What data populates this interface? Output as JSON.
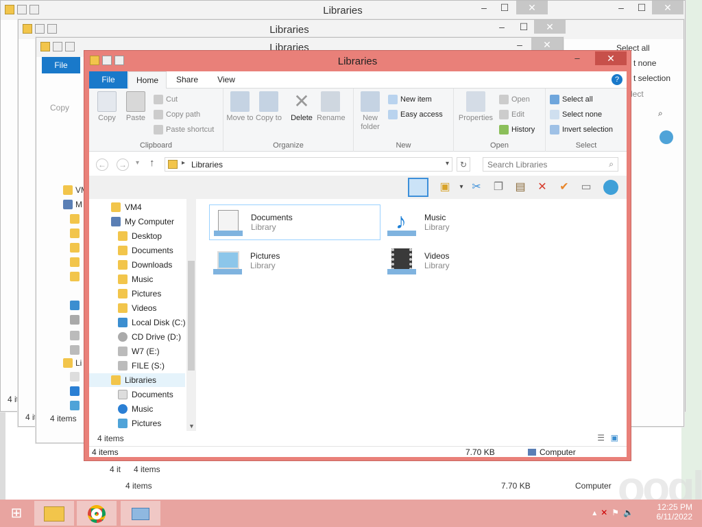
{
  "background_windows": [
    {
      "title": "Libraries",
      "status_text": "4 it"
    },
    {
      "title": "Libraries",
      "status_text": "4 it"
    },
    {
      "title": "Libraries",
      "status_text": "4 items"
    }
  ],
  "bg_right_panel": {
    "select_all": "Select all",
    "select_none": "t none",
    "invert": "t selection",
    "select_group": "lect"
  },
  "bg_lower_status": {
    "items_a": "4 it",
    "items_b": "4 items",
    "items_c": "4 items",
    "size": "7.70 KB",
    "computer": "Computer"
  },
  "bg_left_labels": {
    "file": "File",
    "copy": "Copy",
    "vm": "VM",
    "m": "M",
    "li": "Li",
    "four": "4 it",
    "items": "4 items"
  },
  "main": {
    "title": "Libraries",
    "tabs": [
      "File",
      "Home",
      "Share",
      "View"
    ],
    "ribbon": {
      "copy": "Copy",
      "paste": "Paste",
      "cut": "Cut",
      "copy_path": "Copy path",
      "paste_shortcut": "Paste shortcut",
      "clipboard": "Clipboard",
      "move_to": "Move to",
      "copy_to": "Copy to",
      "delete": "Delete",
      "rename": "Rename",
      "organize": "Organize",
      "new_folder": "New folder",
      "new_item": "New item",
      "easy_access": "Easy access",
      "new": "New",
      "properties": "Properties",
      "open": "Open",
      "edit": "Edit",
      "history": "History",
      "open_group": "Open",
      "select_all": "Select all",
      "select_none": "Select none",
      "invert_selection": "Invert selection",
      "select": "Select"
    },
    "address": {
      "path": "Libraries",
      "search_placeholder": "Search Libraries"
    },
    "nav_tree": [
      "VM4",
      "My Computer",
      "Desktop",
      "Documents",
      "Downloads",
      "Music",
      "Pictures",
      "Videos",
      "Local Disk (C:)",
      "CD Drive (D:)",
      "W7 (E:)",
      "FILE (S:)",
      "Libraries",
      "Documents",
      "Music",
      "Pictures"
    ],
    "libraries": [
      {
        "name": "Documents",
        "type": "Library"
      },
      {
        "name": "Music",
        "type": "Library"
      },
      {
        "name": "Pictures",
        "type": "Library"
      },
      {
        "name": "Videos",
        "type": "Library"
      }
    ],
    "inner_status": "4 items",
    "status": {
      "items": "4 items",
      "size": "7.70 KB",
      "location": "Computer"
    }
  },
  "taskbar": {
    "time": "12:25 PM",
    "date": "6/11/2022"
  },
  "colors": {
    "accent": "#1979ca",
    "active_frame": "#e98079",
    "taskbar": "#e8a4a0"
  }
}
